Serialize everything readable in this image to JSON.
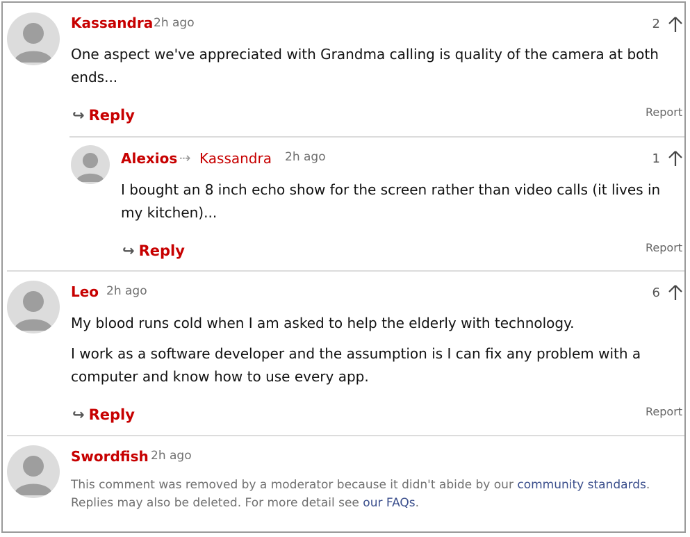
{
  "comments": [
    {
      "author": "Kassandra",
      "time": "2h ago",
      "votes": "2",
      "body": "One aspect we've appreciated with Grandma calling is quality of the camera at both ends...",
      "reply_label": "Reply",
      "report_label": "Report"
    },
    {
      "author": "Alexios",
      "reply_to": "Kassandra",
      "time": "2h ago",
      "votes": "1",
      "body": "I bought an 8 inch echo show for the screen rather than video calls (it lives in my kitchen)...",
      "reply_label": "Reply",
      "report_label": "Report"
    },
    {
      "author": "Leo",
      "time": "2h ago",
      "votes": "6",
      "body_paragraphs": [
        "My blood runs cold when I am asked to help the elderly with technology.",
        "I work as a software developer and the assumption is I can fix any problem with a computer and know how to use every app."
      ],
      "reply_label": "Reply",
      "report_label": "Report"
    },
    {
      "author": "Swordfish",
      "time": "2h ago",
      "removed_prefix": "This comment was removed by a moderator because it didn't abide by our ",
      "removed_link1": "community standards",
      "removed_middle": ". Replies may also be deleted. For more detail see ",
      "removed_link2": "our FAQs",
      "removed_suffix": "."
    }
  ],
  "icons": {
    "reply_arrow": "arrow-right-icon",
    "upvote": "arrow-up-icon",
    "avatar": "user-avatar-icon"
  },
  "colors": {
    "author": "#c70000",
    "link": "#3a4e8c",
    "muted": "#707070",
    "divider": "#dcdcdc"
  }
}
